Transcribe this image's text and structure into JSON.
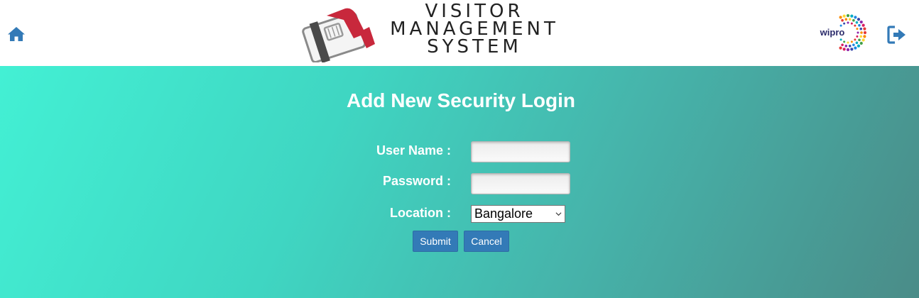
{
  "header": {
    "logo_lines": [
      "VISITOR",
      "MANAGEMENT",
      "SYSTEM"
    ],
    "brand_logo_text": "wipro",
    "home_icon": "home-icon",
    "logout_icon": "sign-out-icon"
  },
  "form": {
    "title": "Add New Security Login",
    "username_label": "User Name :",
    "username_value": "",
    "password_label": "Password :",
    "password_value": "",
    "location_label": "Location :",
    "location_selected": "Bangalore",
    "submit_label": "Submit",
    "cancel_label": "Cancel"
  },
  "colors": {
    "accent": "#337ab7",
    "logo_red": "#c8283c",
    "logo_gray": "#4a4a4a",
    "gradient_start": "#43f0d4",
    "gradient_end": "#4a8c88"
  }
}
